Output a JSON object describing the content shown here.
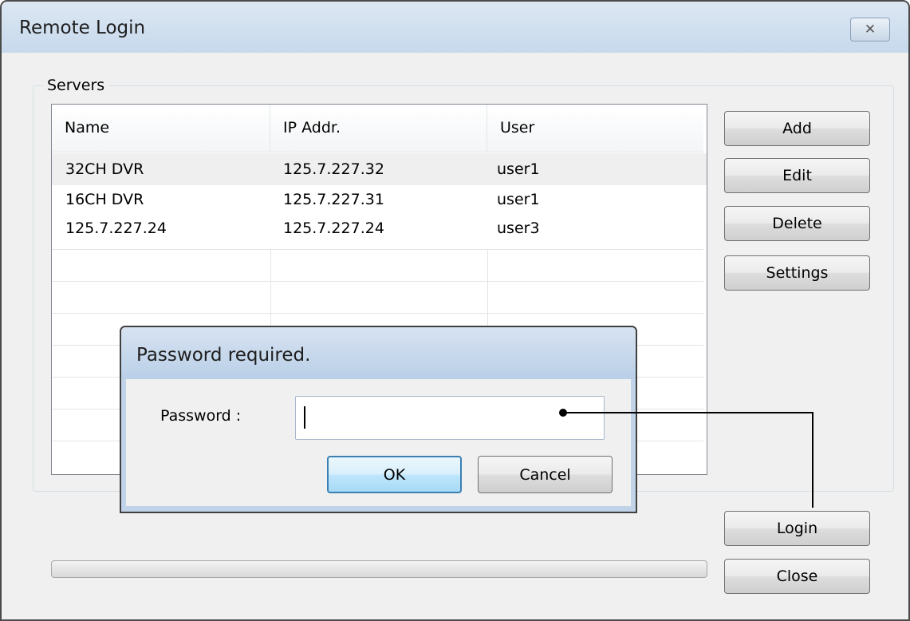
{
  "window": {
    "title": "Remote Login",
    "close_glyph": "✕"
  },
  "servers": {
    "label": "Servers",
    "columns": [
      "Name",
      "IP Addr.",
      "User"
    ],
    "rows": [
      {
        "name": "32CH DVR",
        "ip": "125.7.227.32",
        "user": "user1",
        "selected": true
      },
      {
        "name": "16CH DVR",
        "ip": "125.7.227.31",
        "user": "user1",
        "selected": false
      },
      {
        "name": "125.7.227.24",
        "ip": "125.7.227.24",
        "user": "user3",
        "selected": false
      }
    ]
  },
  "side_buttons": {
    "add": "Add",
    "edit": "Edit",
    "delete": "Delete",
    "settings": "Settings"
  },
  "bottom_buttons": {
    "login": "Login",
    "close": "Close"
  },
  "progress": {
    "value": 0
  },
  "dialog": {
    "title": "Password required.",
    "password_label": "Password :",
    "password_value": "",
    "ok": "OK",
    "cancel": "Cancel"
  },
  "colors": {
    "ok_border": "#3c7fb1",
    "title_bar": "#c7d9ec"
  }
}
